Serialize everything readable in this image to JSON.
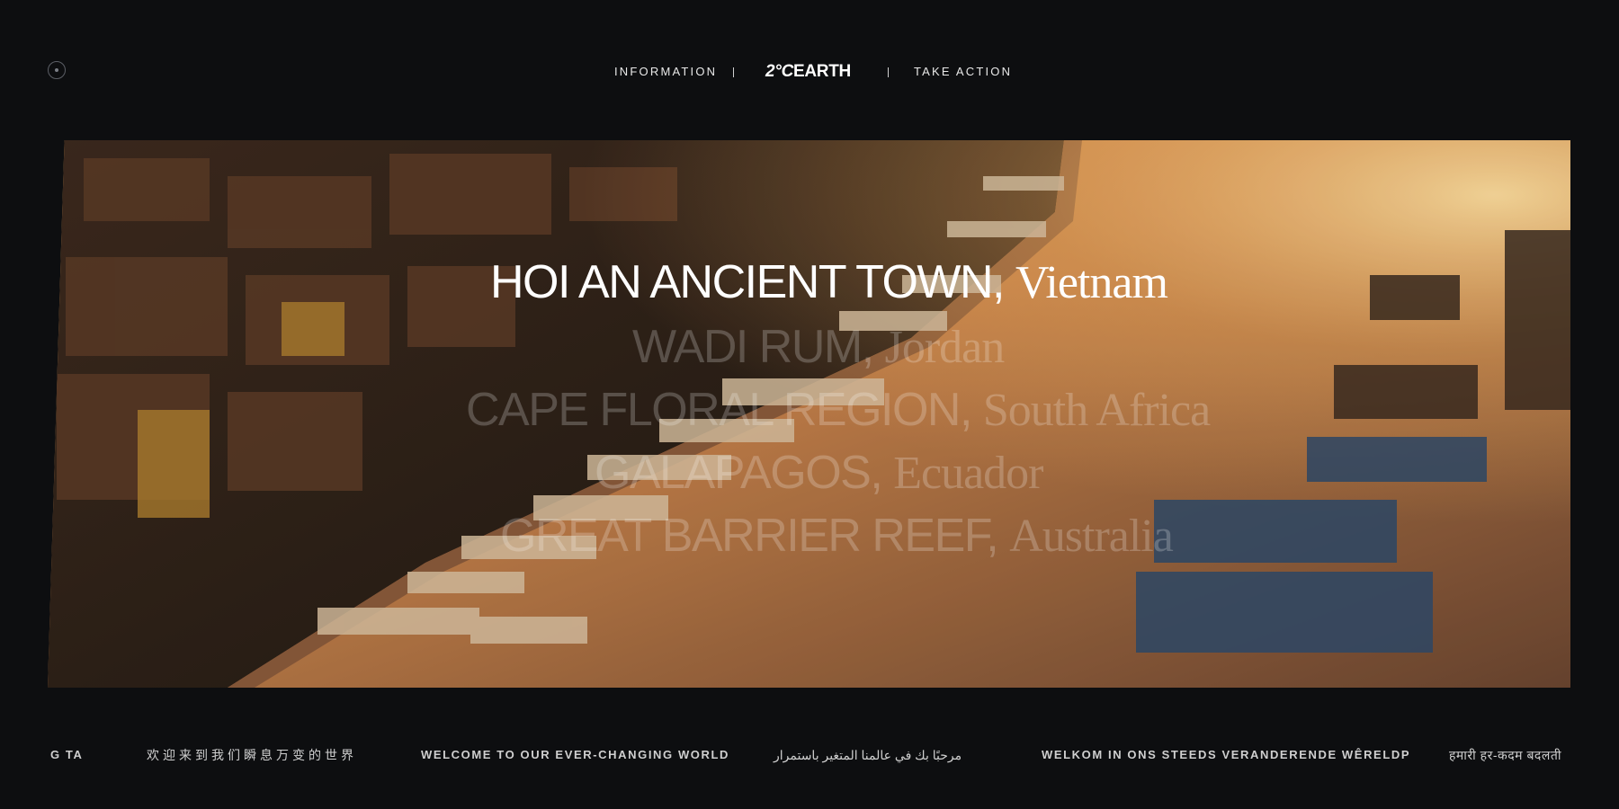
{
  "nav": {
    "menu_icon": "menu-dot-icon",
    "left_link": "INFORMATION",
    "logo_prefix": "2°C",
    "logo_word": "EARTH",
    "right_link": "TAKE ACTION"
  },
  "hero": {
    "image": "aerial-river-boats-sunset",
    "places": [
      {
        "name": "HOI AN ANCIENT TOWN,",
        "country": "Vietnam",
        "active": true
      },
      {
        "name": "WADI RUM,",
        "country": "Jordan",
        "active": false
      },
      {
        "name": "CAPE FLORAL REGION,",
        "country": "South Africa",
        "active": false
      },
      {
        "name": "GALAPAGOS,",
        "country": "Ecuador",
        "active": false
      },
      {
        "name": "GREAT BARRIER REEF,",
        "country": "Australia",
        "active": false
      }
    ]
  },
  "ticker": {
    "items": [
      "G TA",
      "欢迎来到我们瞬息万变的世界",
      "WELCOME TO OUR EVER-CHANGING WORLD",
      "مرحبًا بك في عالمنا المتغير باستمرار",
      "WELKOM IN ONS STEEDS VERANDERENDE WÊRELDP",
      "हमारी हर-कदम बदलती"
    ]
  },
  "colors": {
    "background": "#0d0e10",
    "text": "#ffffff",
    "sunset": "#e8a040"
  }
}
